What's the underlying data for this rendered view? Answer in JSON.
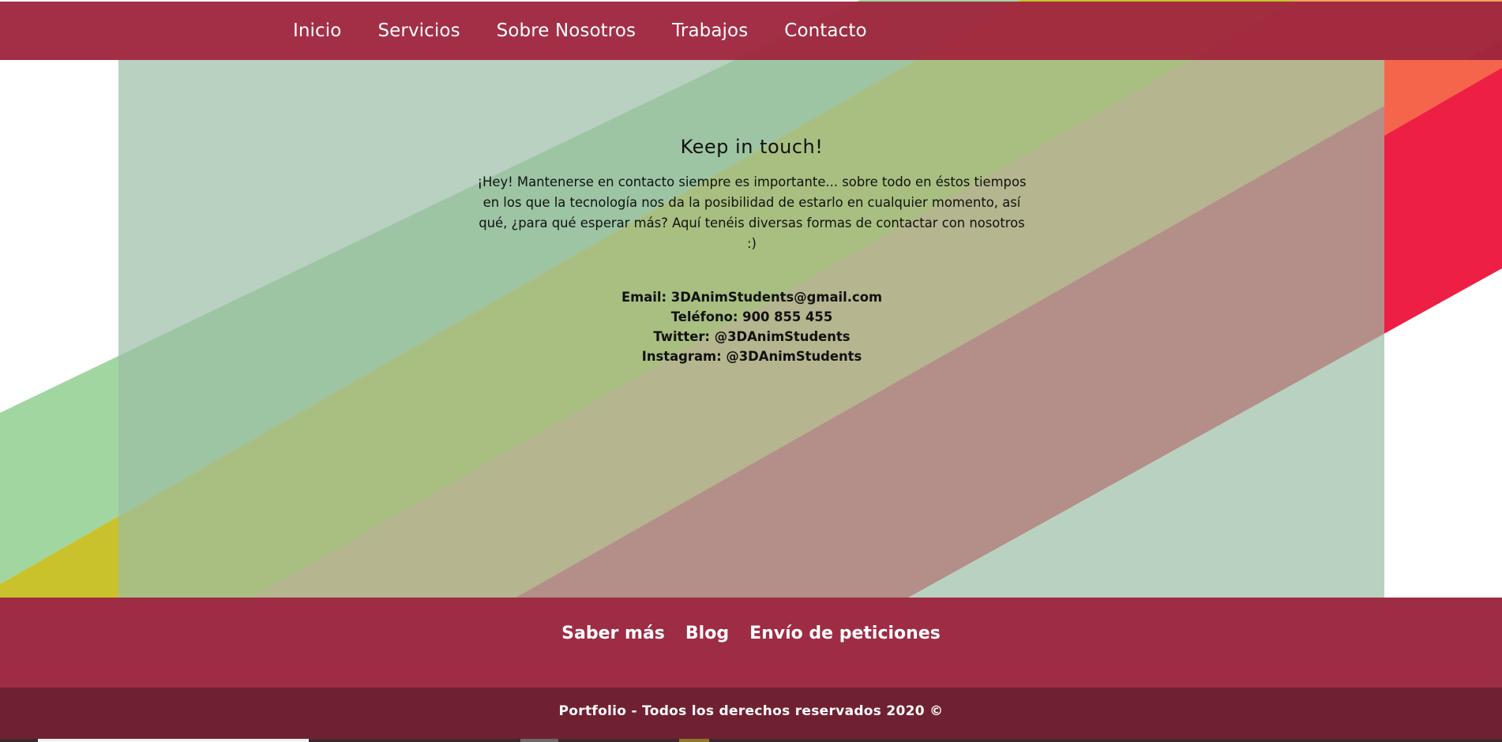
{
  "nav": {
    "items": [
      {
        "label": "Inicio"
      },
      {
        "label": "Servicios"
      },
      {
        "label": "Sobre Nosotros"
      },
      {
        "label": "Trabajos"
      },
      {
        "label": "Contacto"
      }
    ]
  },
  "contact": {
    "title": "Keep in touch!",
    "intro": "¡Hey! Mantenerse en contacto siempre es importante... sobre todo en éstos tiempos en los que la tecnología nos da la posibilidad de estarlo en cualquier momento, así qué, ¿para qué esperar más? Aquí tenéis diversas formas de contactar con nosotros :)",
    "email": "Email: 3DAnimStudents@gmail.com",
    "phone": "Teléfono: 900 855 455",
    "twitter": "Twitter: @3DAnimStudents",
    "instagram": "Instagram: @3DAnimStudents"
  },
  "footer": {
    "links": [
      {
        "label": "Saber más"
      },
      {
        "label": "Blog"
      },
      {
        "label": "Envío de peticiones"
      }
    ],
    "copyright": "Portfolio - Todos los derechos reservados 2020 ©"
  },
  "colors": {
    "nav_bg": "#9f2640",
    "footer_bg": "#9e2c44",
    "footer_bottom_bg": "#702131",
    "stripe_green": "#a2d6a1",
    "stripe_yellow": "#c9c22c",
    "stripe_orange": "#f0a25d",
    "stripe_red": "#ed1f45",
    "stripe_coral": "#f5654c"
  }
}
